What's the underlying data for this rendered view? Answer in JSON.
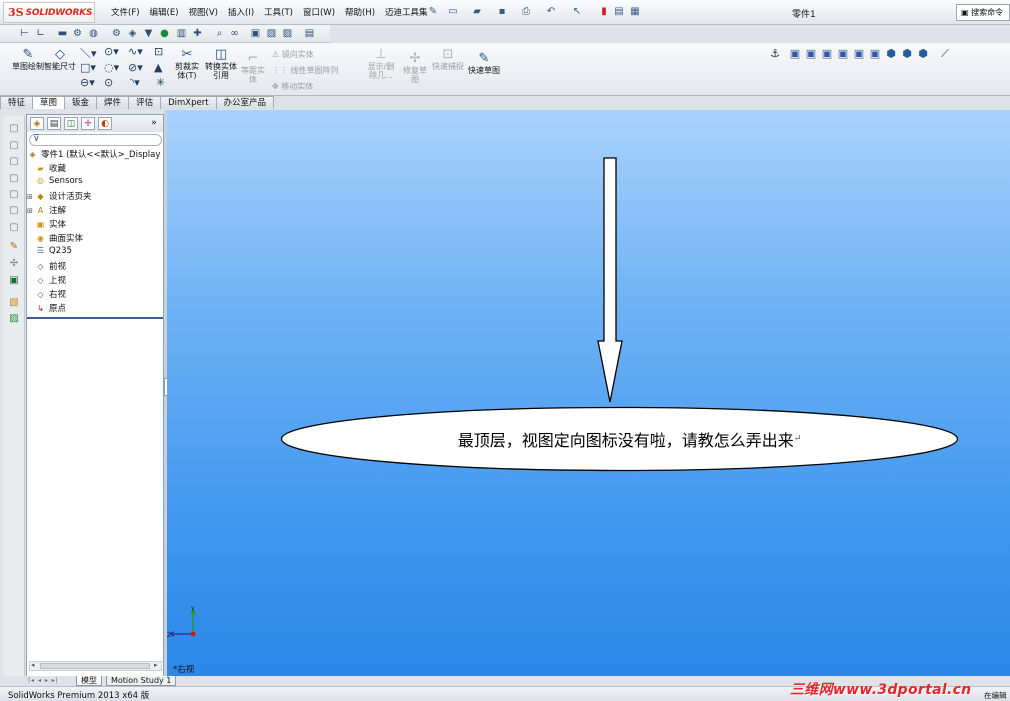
{
  "app": {
    "logo_ds": "3S",
    "logo_name": "SOLIDWORKS",
    "document_title": "零件1",
    "search_placeholder": "搜索命令"
  },
  "menu": [
    "文件(F)",
    "编辑(E)",
    "视图(V)",
    "插入(I)",
    "工具(T)",
    "窗口(W)",
    "帮助(H)",
    "迈迪工具集"
  ],
  "command_manager": {
    "sketch": "草图绘制",
    "smart_dim": "智能尺寸",
    "trim": "剪裁实体(T)",
    "convert": "转换实体引用",
    "offset": "等距实体",
    "mirror": "镜向实体",
    "linear_pattern": "线性草图阵列",
    "move": "移动实体",
    "display_delete": "显示/删除几...",
    "repair": "修复草图",
    "quick_snap": "快速捕捉",
    "rapid_sketch": "快速草图"
  },
  "tabs": [
    "特征",
    "草图",
    "钣金",
    "焊件",
    "评估",
    "DimXpert",
    "办公室产品"
  ],
  "active_tab_index": 1,
  "tree": {
    "root": "零件1  (默认<<默认>_Display",
    "items": [
      "收藏",
      "Sensors",
      "设计活页夹",
      "注解",
      "实体",
      "曲面实体",
      "Q235",
      "前视",
      "上视",
      "右视",
      "原点"
    ]
  },
  "graphics": {
    "annotation": "最顶层，视图定向图标没有啦，请教怎么弄出来",
    "view_name": "*右视",
    "triad_y": "Y",
    "triad_z": "Z"
  },
  "bottom_tabs": [
    "模型",
    "Motion Study 1"
  ],
  "status": {
    "product": "SolidWorks Premium 2013 x64 版",
    "mode": "在编辑",
    "watermark": "三维网www.3dportal.cn"
  },
  "colors": {
    "accent_red": "#d52b1e",
    "viewport_top": "#a9d2fb",
    "viewport_bottom": "#2a86e6",
    "watermark": "#e8262c"
  }
}
